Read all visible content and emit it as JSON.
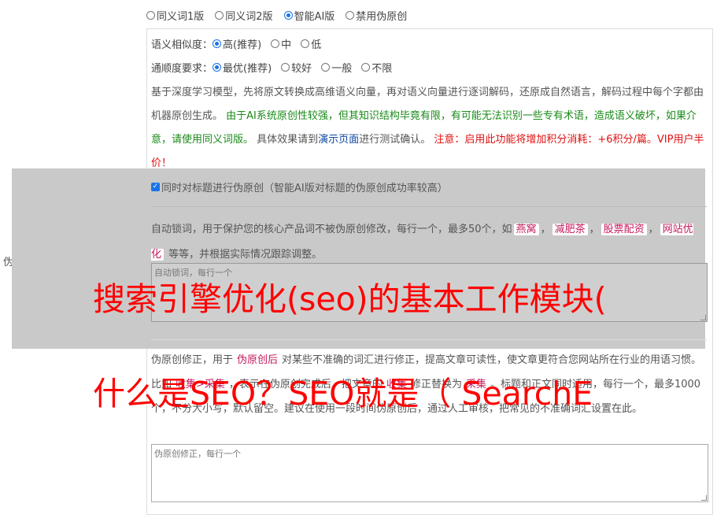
{
  "section_label": "伪原创设置",
  "versions": [
    {
      "label": "同义词1版",
      "checked": false
    },
    {
      "label": "同义词2版",
      "checked": false
    },
    {
      "label": "智能AI版",
      "checked": true
    },
    {
      "label": "禁用伪原创",
      "checked": false
    }
  ],
  "similarity": {
    "label": "语义相似度：",
    "options": [
      {
        "label": "高(推荐)",
        "checked": true
      },
      {
        "label": "中",
        "checked": false
      },
      {
        "label": "低",
        "checked": false
      }
    ]
  },
  "fluency": {
    "label": "通顺度要求：",
    "options": [
      {
        "label": "最优(推荐)",
        "checked": true
      },
      {
        "label": "较好",
        "checked": false
      },
      {
        "label": "一般",
        "checked": false
      },
      {
        "label": "不限",
        "checked": false
      }
    ]
  },
  "description": {
    "part1": "基于深度学习模型，先将原文转换成高维语义向量，再对语义向量进行逐词解码，还原成自然语言，解码过程中每个字都由机器原创生成。",
    "part2_green": "由于AI系统原创性较强，但其知识结构毕竟有限，有可能无法识别一些专有术语，造成语义破坏，如果介意，请使用同义词版。",
    "part3": "具体效果请到",
    "link": "演示页面",
    "part4": "进行测试确认。",
    "part5_red": "注意：启用此功能将增加积分消耗：+6积分/篇。VIP用户半价！"
  },
  "title_checkbox": {
    "label": "同时对标题进行伪原创（智能AI版对标题的伪原创成功率较高）",
    "checked": true
  },
  "lock_words": {
    "text1": "自动锁词，用于保护您的核心产品词不被伪原创修改，每行一个，最多50个，如",
    "tags": [
      "燕窝",
      "减肥茶",
      "股票配资",
      "网站优化"
    ],
    "text2": "等等，并根据实际情况跟踪调整。",
    "placeholder": "自动锁词，每行一个"
  },
  "fix_words": {
    "text1": "伪原创修正，用于",
    "tag1": "伪原创后",
    "text2": "对某些不准确的词汇进行修正，提高文章可读性，使文章更符合您网站所在行业的用语习惯。比如",
    "tag2": "收集>采集",
    "text3": "，表示在伪原创完成后，把文章的",
    "tag3": "收集",
    "text4": "修正替换为",
    "tag4": "采集",
    "text5": "。标题和正文同时适用，每行一个，最多1000个，不分大小写，默认留空。建议在使用一段时间伪原创后，通过人工审核，把常见的不准确词汇设置在此。",
    "placeholder": "伪原创修正，每行一个"
  },
  "overlay_text": {
    "line1": "搜索引擎优化(seo)的基本工作模块(",
    "line2": "什么是SEO？SEO就是（ SearchE"
  },
  "colors": {
    "accent": "#1a73e8",
    "green": "#1a8a1a",
    "red": "#e01010",
    "overlay": "#c9c9c9",
    "watermark_red": "#ff0000"
  }
}
